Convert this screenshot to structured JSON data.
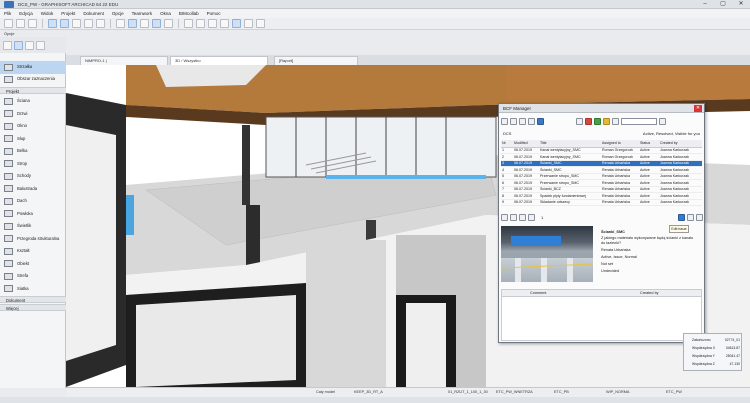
{
  "window": {
    "title": "DCS_PW - GRAPHISOFT ARCHICAD 64 22 EDU",
    "minimize": "–",
    "maximize": "▢",
    "close": "✕"
  },
  "menu": [
    "Plik",
    "Edycja",
    "Widok",
    "Projekt",
    "Dokument",
    "Opcje",
    "Teamwork",
    "Okna",
    "BIMcollab",
    "Pomoc"
  ],
  "options_label": "Opcje",
  "tabs": [
    {
      "label": "NIMPRO-1 |"
    },
    {
      "label": "3D / Wszystko"
    },
    {
      "label": "[Raport]"
    }
  ],
  "toolbox": {
    "selected": "Strzałka",
    "items_top": [
      "Strzałka",
      "Obszar zaznaczenia"
    ],
    "group_projekt": "Projekt",
    "items": [
      "Ściana",
      "Drzwi",
      "Okno",
      "Słup",
      "Belka",
      "Strop",
      "Schody",
      "Balustrada",
      "Dach",
      "Powłoka",
      "Świetlik",
      "Przegroda strukturalna",
      "Kształt",
      "Obiekt",
      "Strefa",
      "Siatka"
    ],
    "group_dokument": "Dokument",
    "group_wiecej": "Więcej"
  },
  "status": {
    "zoom": "Cały model",
    "layer": "KEEP_3D_RT_A",
    "story": "01_RZUT_1_100_1_30",
    "pen": "ETC_PW_WNETRZA",
    "penset": "ETC_PB",
    "model": "WIP_NORMA",
    "renov": "ETC_PW"
  },
  "bcf": {
    "title": "BCF Manager",
    "close": "✕",
    "project": "DCS",
    "filter": "Active, Resolved, Visible for you",
    "columns": [
      "Nr",
      "Modified",
      "Title",
      "Assigned to",
      "Status",
      "Created by"
    ],
    "issues": [
      {
        "nr": "1",
        "modified": "06.07.2019",
        "title": "Kanał wentylacyjny_SMC",
        "assigned": "Roman Grzegorczk",
        "status": "Active",
        "created": "Joanna Karkurzak"
      },
      {
        "nr": "2",
        "modified": "06.07.2019",
        "title": "Kanał wentylacyjny_SMC",
        "assigned": "Roman Grzegorczk",
        "status": "Active",
        "created": "Joanna Karkurzak"
      },
      {
        "nr": "3",
        "modified": "06.07.2019",
        "title": "Ścianki_SMC",
        "assigned": "Renata Urbańska",
        "status": "Active",
        "created": "Joanna Karkurzak",
        "selected": true
      },
      {
        "nr": "4",
        "modified": "06.07.2019",
        "title": "Ścianki_SMC",
        "assigned": "Renata Urbańska",
        "status": "Active",
        "created": "Joanna Karkurzak"
      },
      {
        "nr": "5",
        "modified": "06.07.2019",
        "title": "Przerwanie stropu_SMC",
        "assigned": "Renata Urbańska",
        "status": "Active",
        "created": "Joanna Karkurzak"
      },
      {
        "nr": "6",
        "modified": "06.07.2019",
        "title": "Przerwanie stropu_SMC",
        "assigned": "Renata Urbańska",
        "status": "Active",
        "created": "Joanna Karkurzak"
      },
      {
        "nr": "7",
        "modified": "06.07.2019",
        "title": "Ścianki_BCZ",
        "assigned": "Renata Urbańska",
        "status": "Active",
        "created": "Joanna Karkurzak"
      },
      {
        "nr": "8",
        "modified": "06.07.2019",
        "title": "Spadek płyty fundamentowej",
        "assigned": "Renata Urbańska",
        "status": "Active",
        "created": "Joanna Karkurzak"
      },
      {
        "nr": "9",
        "modified": "06.07.2019",
        "title": "Składanie odszecy",
        "assigned": "Renata Urbańska",
        "status": "Active",
        "created": "Joanna Karkurzak"
      }
    ],
    "detail": {
      "title": "Ścianki_SMC",
      "description": "Z jakiego materiału wykonywane będą ścianki z kanału do łazienki?",
      "assigned": "Renata Urbańska",
      "state": "Active, Issue, Normal",
      "due": "Not set",
      "labels": "Undecided"
    },
    "comments": {
      "col_comment": "Comment",
      "col_created": "Created by"
    },
    "tooltip": "Edit issue",
    "page_no": "1"
  },
  "navpanel": {
    "rows": [
      {
        "label": "Zakończono",
        "value": "02774_01"
      },
      {
        "label": "Współrzędna X",
        "value": "04613.87"
      },
      {
        "label": "Współrzędna Y",
        "value": "25041.47"
      },
      {
        "label": "Współrzędna Z",
        "value": "47.130"
      }
    ]
  }
}
